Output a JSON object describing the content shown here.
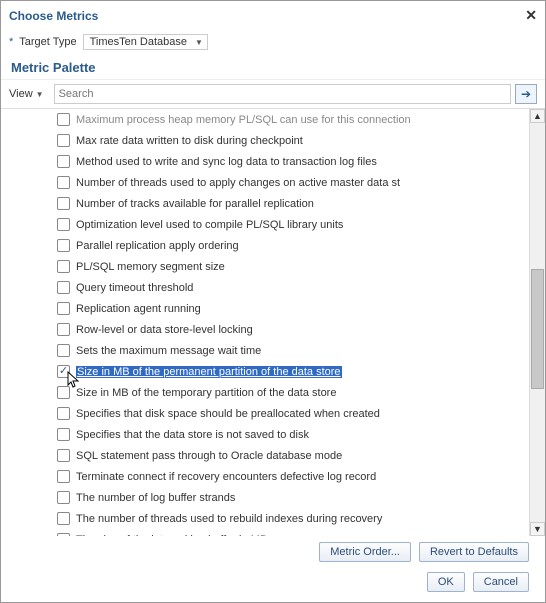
{
  "dialog": {
    "title": "Choose Metrics",
    "target_label_star": "*",
    "target_label": "Target Type",
    "target_value": "TimesTen Database",
    "section_title": "Metric Palette"
  },
  "toolbar": {
    "view_label": "View",
    "search_placeholder": "Search"
  },
  "list": {
    "truncated_top": "Maximum process heap memory PL/SQL can use for this connection",
    "items": [
      {
        "label": "Max rate data written to disk during checkpoint",
        "checked": false,
        "selected": false
      },
      {
        "label": "Method used to write and sync log data to transaction log files",
        "checked": false,
        "selected": false
      },
      {
        "label": "Number of threads used to apply changes on active master data st",
        "checked": false,
        "selected": false
      },
      {
        "label": "Number of tracks available for parallel replication",
        "checked": false,
        "selected": false
      },
      {
        "label": "Optimization level used to compile PL/SQL library units",
        "checked": false,
        "selected": false
      },
      {
        "label": "Parallel replication apply ordering",
        "checked": false,
        "selected": false
      },
      {
        "label": "PL/SQL memory segment size",
        "checked": false,
        "selected": false
      },
      {
        "label": "Query timeout threshold",
        "checked": false,
        "selected": false
      },
      {
        "label": "Replication agent running",
        "checked": false,
        "selected": false
      },
      {
        "label": "Row-level or data store-level locking",
        "checked": false,
        "selected": false
      },
      {
        "label": "Sets the maximum message wait time",
        "checked": false,
        "selected": false
      },
      {
        "label": "Size in MB of the permanent partition of the data store",
        "checked": true,
        "selected": true
      },
      {
        "label": "Size in MB of the temporary partition of the data store",
        "checked": false,
        "selected": false
      },
      {
        "label": "Specifies that disk space should be preallocated when created",
        "checked": false,
        "selected": false
      },
      {
        "label": "Specifies that the data store is not saved to disk",
        "checked": false,
        "selected": false
      },
      {
        "label": "SQL statement pass through to Oracle database mode",
        "checked": false,
        "selected": false
      },
      {
        "label": "Terminate connect if recovery encounters defective log record",
        "checked": false,
        "selected": false
      },
      {
        "label": "The number of log buffer strands",
        "checked": false,
        "selected": false
      },
      {
        "label": "The number of threads used to rebuild indexes during recovery",
        "checked": false,
        "selected": false
      },
      {
        "label": "The size of the internal log buffer in MB",
        "checked": false,
        "selected": false
      }
    ]
  },
  "buttons": {
    "metric_order": "Metric Order...",
    "revert": "Revert to Defaults",
    "ok": "OK",
    "cancel": "Cancel"
  }
}
